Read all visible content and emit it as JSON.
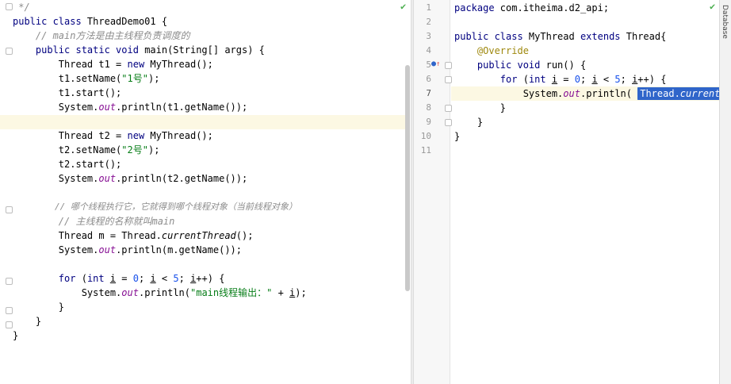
{
  "left_editor": {
    "lines": [
      {
        "t": " */",
        "c": "cmt"
      },
      {
        "t": "public class ThreadDemo01 {"
      },
      {
        "t": "    // main方法是由主线程负责调度的",
        "c": "cmt"
      },
      {
        "t": "    public static void main(String[] args) {"
      },
      {
        "t": "        Thread t1 = new MyThread();"
      },
      {
        "t": "        t1.setName(\"1号\");"
      },
      {
        "t": "        t1.start();"
      },
      {
        "t": "        System.out.println(t1.getName());"
      },
      {
        "t": ""
      },
      {
        "t": "        Thread t2 = new MyThread();"
      },
      {
        "t": "        t2.setName(\"2号\");"
      },
      {
        "t": "        t2.start();"
      },
      {
        "t": "        System.out.println(t2.getName());"
      },
      {
        "t": ""
      },
      {
        "t": "        // 哪个线程执行它，它就得到哪个线程对象（当前线程对象）",
        "c": "cmt"
      },
      {
        "t": "        // 主线程的名称就叫main",
        "c": "cmt"
      },
      {
        "t": "        Thread m = Thread.currentThread();"
      },
      {
        "t": "        System.out.println(m.getName());"
      },
      {
        "t": ""
      },
      {
        "t": "        for (int i = 0; i < 5; i++) {"
      },
      {
        "t": "            System.out.println(\"main线程输出：\" + i);"
      },
      {
        "t": "        }"
      },
      {
        "t": "    }"
      },
      {
        "t": "}"
      }
    ]
  },
  "right_editor": {
    "line_numbers": [
      "1",
      "2",
      "3",
      "4",
      "5",
      "6",
      "7",
      "8",
      "9",
      "10",
      "11"
    ],
    "lines": [
      {
        "t": "package com.itheima.d2_api;"
      },
      {
        "t": ""
      },
      {
        "t": "public class MyThread extends Thread{"
      },
      {
        "t": "    @Override"
      },
      {
        "t": "    public void run() {"
      },
      {
        "t": "        for (int i = 0; i < 5; i++) {"
      },
      {
        "t": "            System.out.println( Thread.currentThrea"
      },
      {
        "t": "        }"
      },
      {
        "t": "    }"
      },
      {
        "t": "}"
      },
      {
        "t": ""
      }
    ]
  },
  "side_panel": {
    "label": "Database"
  },
  "status": {
    "check_icon": "check-icon",
    "override_icon": "override-gutter-icon"
  },
  "colors": {
    "keyword": "#000080",
    "string": "#067d17",
    "comment": "#8c8c8c",
    "field": "#871094",
    "annotation": "#9e880d",
    "number": "#1750eb",
    "selection": "#2f65ca",
    "caret_line": "#fcf8e3"
  }
}
